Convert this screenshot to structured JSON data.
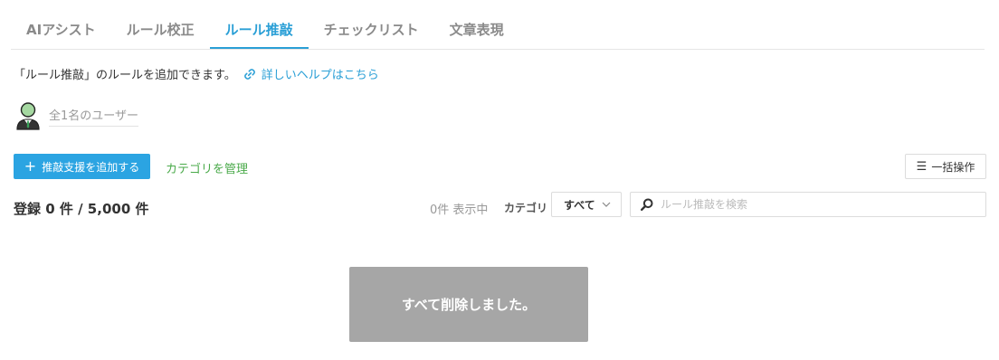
{
  "tabs": [
    {
      "label": "AIアシスト",
      "active": false
    },
    {
      "label": "ルール校正",
      "active": false
    },
    {
      "label": "ルール推敲",
      "active": true
    },
    {
      "label": "チェックリスト",
      "active": false
    },
    {
      "label": "文章表現",
      "active": false
    }
  ],
  "description": {
    "text": "「ルール推敲」のルールを追加できます。",
    "help_link": "詳しいヘルプはこちら",
    "help_icon": "link-icon"
  },
  "users": {
    "label": "全1名のユーザー",
    "avatar_icon": "user-avatar-icon"
  },
  "actions": {
    "add_button": "推敲支援を追加する",
    "add_icon": "plus-icon",
    "manage_categories": "カテゴリを管理",
    "bulk_button": "一括操作",
    "bulk_icon": "menu-icon"
  },
  "list": {
    "count_text": "登録 0 件 / 5,000 件",
    "showing_text": "0件 表示中",
    "category_label": "カテゴリ",
    "category_selected": "すべて",
    "search_placeholder": "ルール推敲を検索",
    "search_value": ""
  },
  "toast": {
    "message": "すべて削除しました。"
  },
  "colors": {
    "accent": "#2a9fd6",
    "button_blue": "#2ba4e2",
    "green_link": "#4aaa4a",
    "toast_bg": "#a6a6a6"
  }
}
